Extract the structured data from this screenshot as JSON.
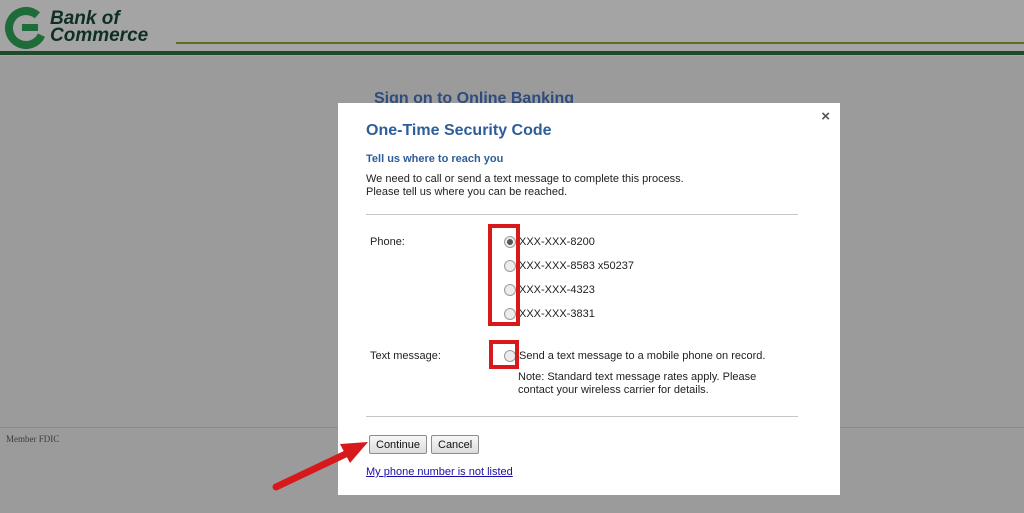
{
  "brand": {
    "name_line1": "Bank of",
    "name_line2": "Commerce"
  },
  "page": {
    "title": "Sign on to Online Banking",
    "footer": "Member FDIC"
  },
  "modal": {
    "close_label": "×",
    "title": "One-Time Security Code",
    "subtitle": "Tell us where to reach you",
    "desc_line1": "We need to call or send a text message to complete this process.",
    "desc_line2": "Please tell us where you can be reached.",
    "phone_label": "Phone:",
    "phone_options": [
      {
        "label": "XXX-XXX-8200",
        "selected": true
      },
      {
        "label": "XXX-XXX-8583 x50237",
        "selected": false
      },
      {
        "label": "XXX-XXX-4323",
        "selected": false
      },
      {
        "label": "XXX-XXX-3831",
        "selected": false
      }
    ],
    "text_label": "Text message:",
    "text_option": "Send a text message to a mobile phone on record.",
    "note_line1": "Note: Standard text message rates apply. Please",
    "note_line2": "contact your wireless carrier for details.",
    "continue_label": "Continue",
    "cancel_label": "Cancel",
    "not_listed_link": "My phone number is not listed"
  },
  "colors": {
    "title_blue": "#2e5d9a",
    "highlight_red": "#d7191c",
    "brand_green": "#1f4a2c"
  }
}
